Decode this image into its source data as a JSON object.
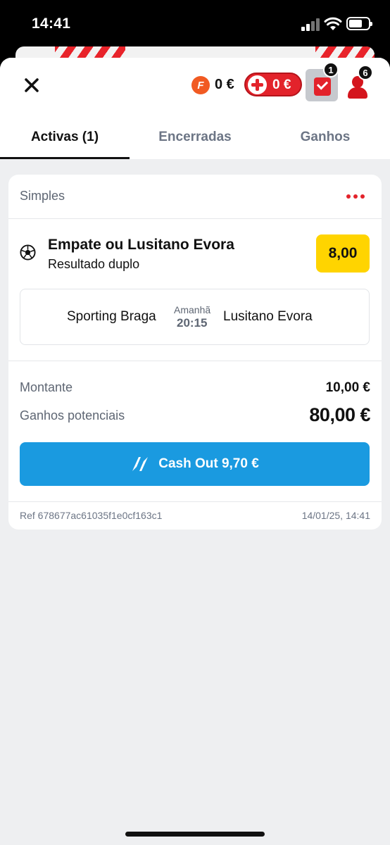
{
  "status_bar": {
    "time": "14:41"
  },
  "header": {
    "coin_letter": "F",
    "coin_amount": "0 €",
    "bonus_amount": "0 €",
    "betslip_badge": "1",
    "profile_badge": "6"
  },
  "tabs": [
    {
      "label": "Activas (1)",
      "active": true
    },
    {
      "label": "Encerradas",
      "active": false
    },
    {
      "label": "Ganhos",
      "active": false
    }
  ],
  "bet": {
    "type": "Simples",
    "selection": "Empate ou Lusitano Evora",
    "market": "Resultado duplo",
    "odds": "8,00",
    "event": {
      "home": "Sporting Braga",
      "day": "Amanhã",
      "time": "20:15",
      "away": "Lusitano Evora"
    },
    "stake_label": "Montante",
    "stake_value": "10,00 €",
    "potential_label": "Ganhos potenciais",
    "potential_value": "80,00 €",
    "cashout_label": "Cash Out 9,70 €",
    "ref": "Ref 678677ac61035f1e0cf163c1",
    "date": "14/01/25, 14:41"
  },
  "colors": {
    "accent_red": "#e3232b",
    "odds_yellow": "#ffd400",
    "cashout_blue": "#1a9ae0",
    "background": "#eeeff1"
  }
}
